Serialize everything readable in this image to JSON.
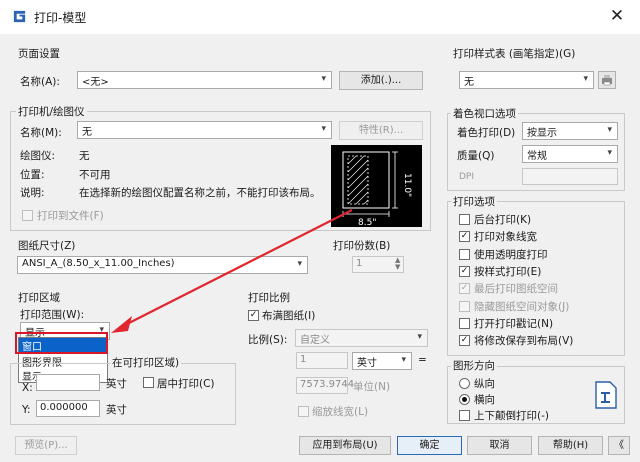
{
  "window": {
    "title": "打印-模型"
  },
  "page_setup": {
    "legend": "页面设置",
    "name_label": "名称(A):",
    "name_value": "<无>",
    "add_button": "添加(.)..."
  },
  "printer": {
    "legend": "打印机/绘图仪",
    "name_label": "名称(M):",
    "name_value": "无",
    "properties_button": "特性(R)...",
    "plotter_label": "绘图仪:",
    "plotter_value": "无",
    "location_label": "位置:",
    "location_value": "不可用",
    "description_label": "说明:",
    "description_value": "在选择新的绘图仪配置名称之前，不能打印该布局。",
    "print_to_file": "打印到文件(F)",
    "preview": {
      "width_label": "8.5\"",
      "height_label": "11.0\""
    }
  },
  "paper_size": {
    "legend": "图纸尺寸(Z)",
    "value": "ANSI_A_(8.50_x_11.00_Inches)"
  },
  "copies": {
    "legend": "打印份数(B)",
    "value": "1"
  },
  "plot_area": {
    "legend": "打印区域",
    "range_label": "打印范围(W):",
    "selected": "显示",
    "options": [
      "窗口",
      "图形界限",
      "显示"
    ],
    "highlighted": "窗口"
  },
  "offset": {
    "legend_fragment": "在可打印区域)",
    "x_label": "X:",
    "x_unit": "英寸",
    "center_label": "居中打印(C)",
    "y_label": "Y:",
    "y_value": "0.000000",
    "y_unit": "英寸"
  },
  "scale": {
    "legend": "打印比例",
    "fit_paper": "布满图纸(I)",
    "scale_label": "比例(S):",
    "scale_value": "自定义",
    "num_value": "1",
    "unit_value": "英寸",
    "eq": "=",
    "den_value": "7573.9744",
    "den_label": "单位(N)",
    "lineweights": "缩放线宽(L)"
  },
  "plot_style": {
    "legend": "打印样式表 (画笔指定)(G)",
    "value": "无"
  },
  "shaded": {
    "legend": "着色视口选项",
    "shade_label": "着色打印(D)",
    "shade_value": "按显示",
    "quality_label": "质量(Q)",
    "quality_value": "常规",
    "dpi_label": "DPI"
  },
  "options": {
    "legend": "打印选项",
    "items": [
      {
        "label": "后台打印(K)",
        "checked": false,
        "disabled": false
      },
      {
        "label": "打印对象线宽",
        "checked": true,
        "disabled": false
      },
      {
        "label": "使用透明度打印",
        "checked": false,
        "disabled": false
      },
      {
        "label": "按样式打印(E)",
        "checked": true,
        "disabled": false
      },
      {
        "label": "最后打印图纸空间",
        "checked": true,
        "disabled": true
      },
      {
        "label": "隐藏图纸空间对象(J)",
        "checked": false,
        "disabled": true
      },
      {
        "label": "打开打印戳记(N)",
        "checked": false,
        "disabled": false
      },
      {
        "label": "将修改保存到布局(V)",
        "checked": true,
        "disabled": false
      }
    ]
  },
  "orientation": {
    "legend": "图形方向",
    "portrait": "纵向",
    "landscape": "横向",
    "upside_down": "上下颠倒打印(-)"
  },
  "footer": {
    "preview": "预览(P)...",
    "apply": "应用到布局(U)",
    "ok": "确定",
    "cancel": "取消",
    "help": "帮助(H)",
    "nav": "《"
  }
}
